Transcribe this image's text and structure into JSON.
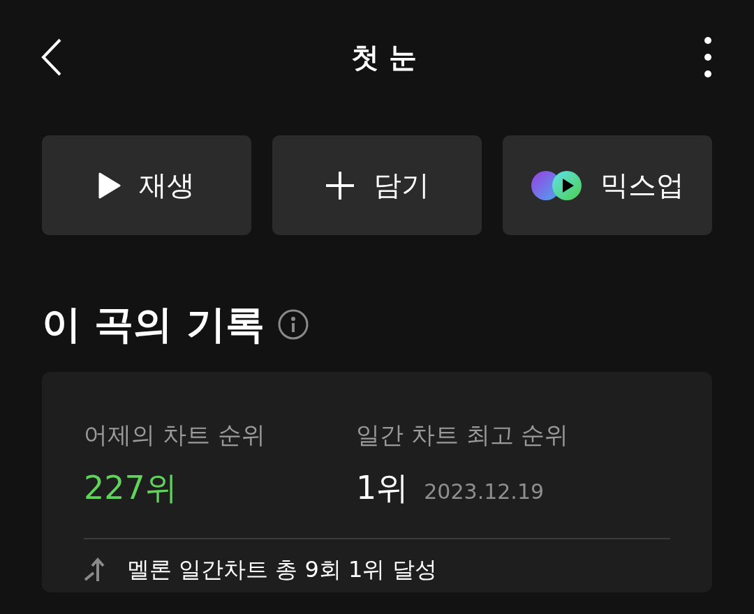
{
  "header": {
    "title": "첫 눈"
  },
  "actions": [
    {
      "kind": "play",
      "label": "재생"
    },
    {
      "kind": "add",
      "label": "담기"
    },
    {
      "kind": "mixup",
      "label": "믹스업"
    }
  ],
  "record": {
    "title": "이 곡의 기록",
    "stats": [
      {
        "label": "어제의 차트 순위",
        "value": "227위",
        "color": "#5fd35a"
      },
      {
        "label": "일간 차트 최고 순위",
        "value": "1위",
        "date": "2023.12.19",
        "color": "#ffffff"
      }
    ],
    "achievement": "멜론 일간차트 총 9회 1위 달성"
  }
}
